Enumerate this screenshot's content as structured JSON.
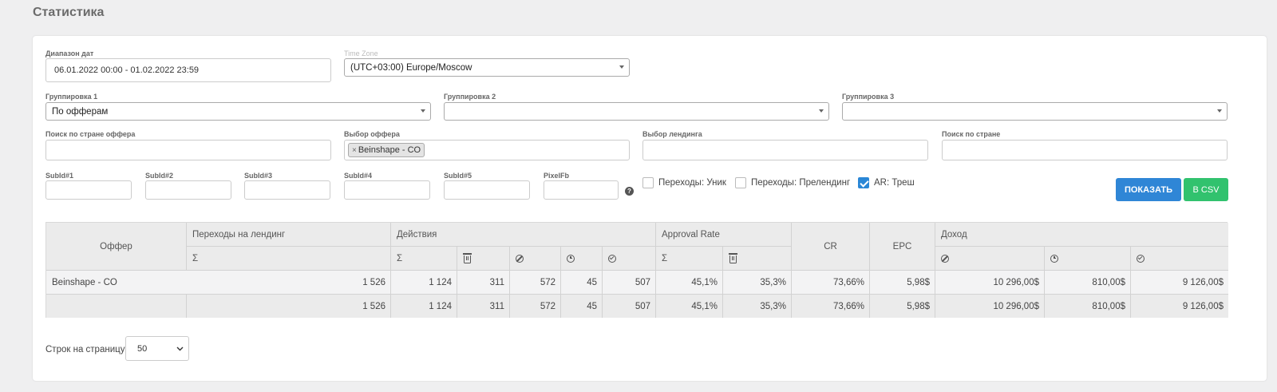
{
  "page_title": "Статистика",
  "filters": {
    "date_range": {
      "label": "Диапазон дат",
      "value": "06.01.2022 00:00 - 01.02.2022 23:59"
    },
    "time_zone": {
      "label": "Time Zone",
      "value": "(UTC+03:00) Europe/Moscow"
    },
    "grouping_1": {
      "label": "Группировка 1",
      "value": "По офферам"
    },
    "grouping_2": {
      "label": "Группировка 2",
      "value": ""
    },
    "grouping_3": {
      "label": "Группировка 3",
      "value": ""
    },
    "offer_country_search": {
      "label": "Поиск по стране оффера",
      "value": ""
    },
    "offer_select": {
      "label": "Выбор оффера",
      "tag": "Beinshape - CO",
      "tag_remove": "×"
    },
    "landing_select": {
      "label": "Выбор лендинга",
      "value": ""
    },
    "country_search": {
      "label": "Поиск по стране",
      "value": ""
    },
    "subids": [
      {
        "label": "SubId#1",
        "value": ""
      },
      {
        "label": "SubId#2",
        "value": ""
      },
      {
        "label": "SubId#3",
        "value": ""
      },
      {
        "label": "SubId#4",
        "value": ""
      },
      {
        "label": "SubId#5",
        "value": ""
      }
    ],
    "pixel_fb": {
      "label": "PixelFb",
      "value": ""
    },
    "help_glyph": "?",
    "checkboxes": [
      {
        "label": "Переходы: Уник",
        "checked": false
      },
      {
        "label": "Переходы: Прелендинг",
        "checked": false
      },
      {
        "label": "AR: Треш",
        "checked": true
      }
    ]
  },
  "buttons": {
    "show": "ПОКАЗАТЬ",
    "csv": "В CSV"
  },
  "table": {
    "headers": {
      "offer": "Оффер",
      "landing_clicks": "Переходы на лендинг",
      "actions": "Действия",
      "approval_rate": "Approval Rate",
      "cr": "CR",
      "epc": "EPC",
      "income": "Доход",
      "sum_symbol": "Σ"
    },
    "rows": [
      {
        "offer": "Beinshape - CO",
        "clicks": "1 526",
        "act_total": "1 124",
        "act_trash": "311",
        "act_rejected": "572",
        "act_pending": "45",
        "act_approved": "507",
        "ar_total": "45,1%",
        "ar_trash": "35,3%",
        "cr": "73,66%",
        "epc": "5,98$",
        "inc_rejected": "10 296,00$",
        "inc_pending": "810,00$",
        "inc_approved": "9 126,00$"
      }
    ],
    "totals": {
      "offer": "",
      "clicks": "1 526",
      "act_total": "1 124",
      "act_trash": "311",
      "act_rejected": "572",
      "act_pending": "45",
      "act_approved": "507",
      "ar_total": "45,1%",
      "ar_trash": "35,3%",
      "cr": "73,66%",
      "epc": "5,98$",
      "inc_rejected": "10 296,00$",
      "inc_pending": "810,00$",
      "inc_approved": "9 126,00$"
    }
  },
  "pagination": {
    "label": "Строк на страницу:",
    "value": "50"
  },
  "colors": {
    "primary": "#2f86d6",
    "success": "#31c26e",
    "checkbox": "#2a87d6"
  },
  "icons": {
    "trash": "trash-icon",
    "rejected": "ban-icon",
    "pending": "clock-icon",
    "approved": "check-circle-icon"
  }
}
